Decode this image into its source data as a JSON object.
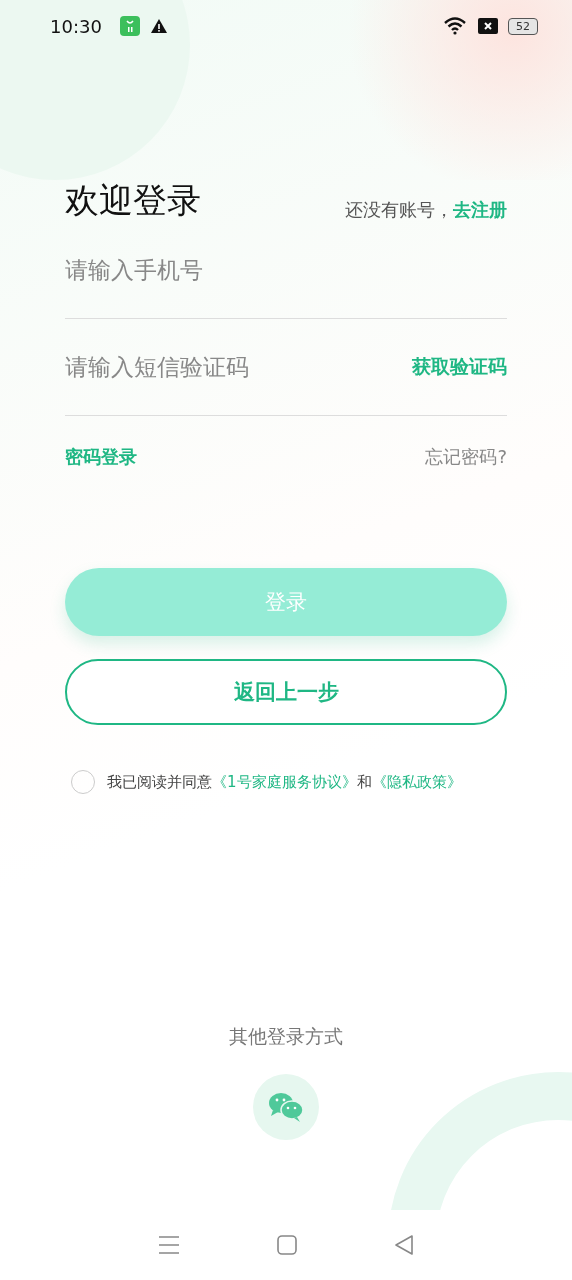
{
  "status_bar": {
    "time": "10:30",
    "battery": "52"
  },
  "header": {
    "title": "欢迎登录",
    "register_prompt": "还没有账号，",
    "register_link": "去注册"
  },
  "phone_field": {
    "placeholder": "请输入手机号"
  },
  "code_field": {
    "placeholder": "请输入短信验证码",
    "get_code": "获取验证码"
  },
  "links": {
    "password_login": "密码登录",
    "forgot_password": "忘记密码?"
  },
  "login_button": {
    "label": "登录",
    "disabled": true
  },
  "back_button": {
    "label": "返回上一步"
  },
  "agreement": {
    "checked": false,
    "text": "我已阅读并同意",
    "terms_link": "《1号家庭服务协议》",
    "joiner": "和",
    "privacy_link": "《隐私政策》"
  },
  "other_login": {
    "title": "其他登录方式"
  }
}
